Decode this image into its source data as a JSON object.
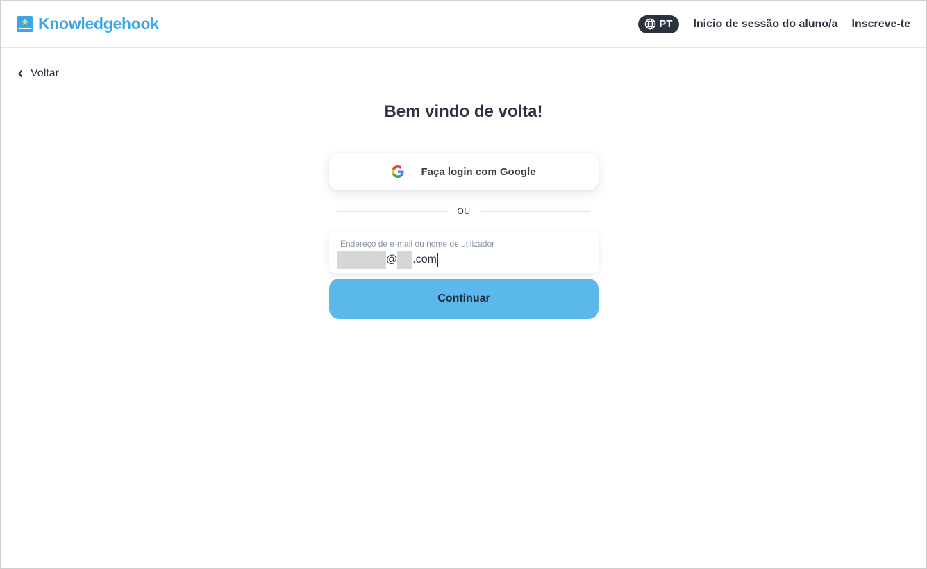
{
  "header": {
    "brand_name": "Knowledgehook",
    "language_code": "PT",
    "student_login_label": "Inicio de sessão do aluno/a",
    "signup_label": "Inscreve-te"
  },
  "back_label": "Voltar",
  "login": {
    "title": "Bem vindo de volta!",
    "google_button_label": "Faça login com Google",
    "divider_text": "OU",
    "email_field_label": "Endereço de e-mail ou nome de utilizador",
    "email_value_at": "@",
    "email_value_domain_suffix": ".com",
    "continue_label": "Continuar"
  },
  "colors": {
    "brand": "#3ba7e6",
    "primary_button": "#5bb8eb",
    "text_dark": "#2b3240"
  },
  "icons": [
    "brand-logo-icon",
    "globe-icon",
    "chevron-left-icon",
    "google-icon"
  ]
}
